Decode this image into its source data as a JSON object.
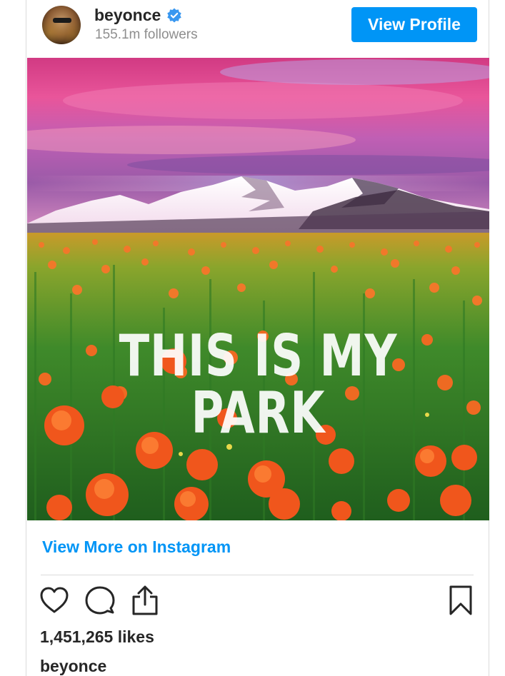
{
  "header": {
    "username": "beyonce",
    "followers": "155.1m followers",
    "view_profile_label": "View Profile"
  },
  "post": {
    "overlay_text": "THIS IS MY PARK"
  },
  "links": {
    "view_more": "View More on Instagram"
  },
  "stats": {
    "likes": "1,451,265 likes"
  },
  "caption": {
    "username": "beyonce"
  },
  "colors": {
    "accent": "#0095f6",
    "text": "#262626",
    "muted": "#8e8e8e",
    "divider": "#dbdbdb"
  },
  "icons": {
    "verified": "verified-badge-icon",
    "like": "heart-icon",
    "comment": "comment-icon",
    "share": "share-icon",
    "save": "bookmark-icon"
  }
}
